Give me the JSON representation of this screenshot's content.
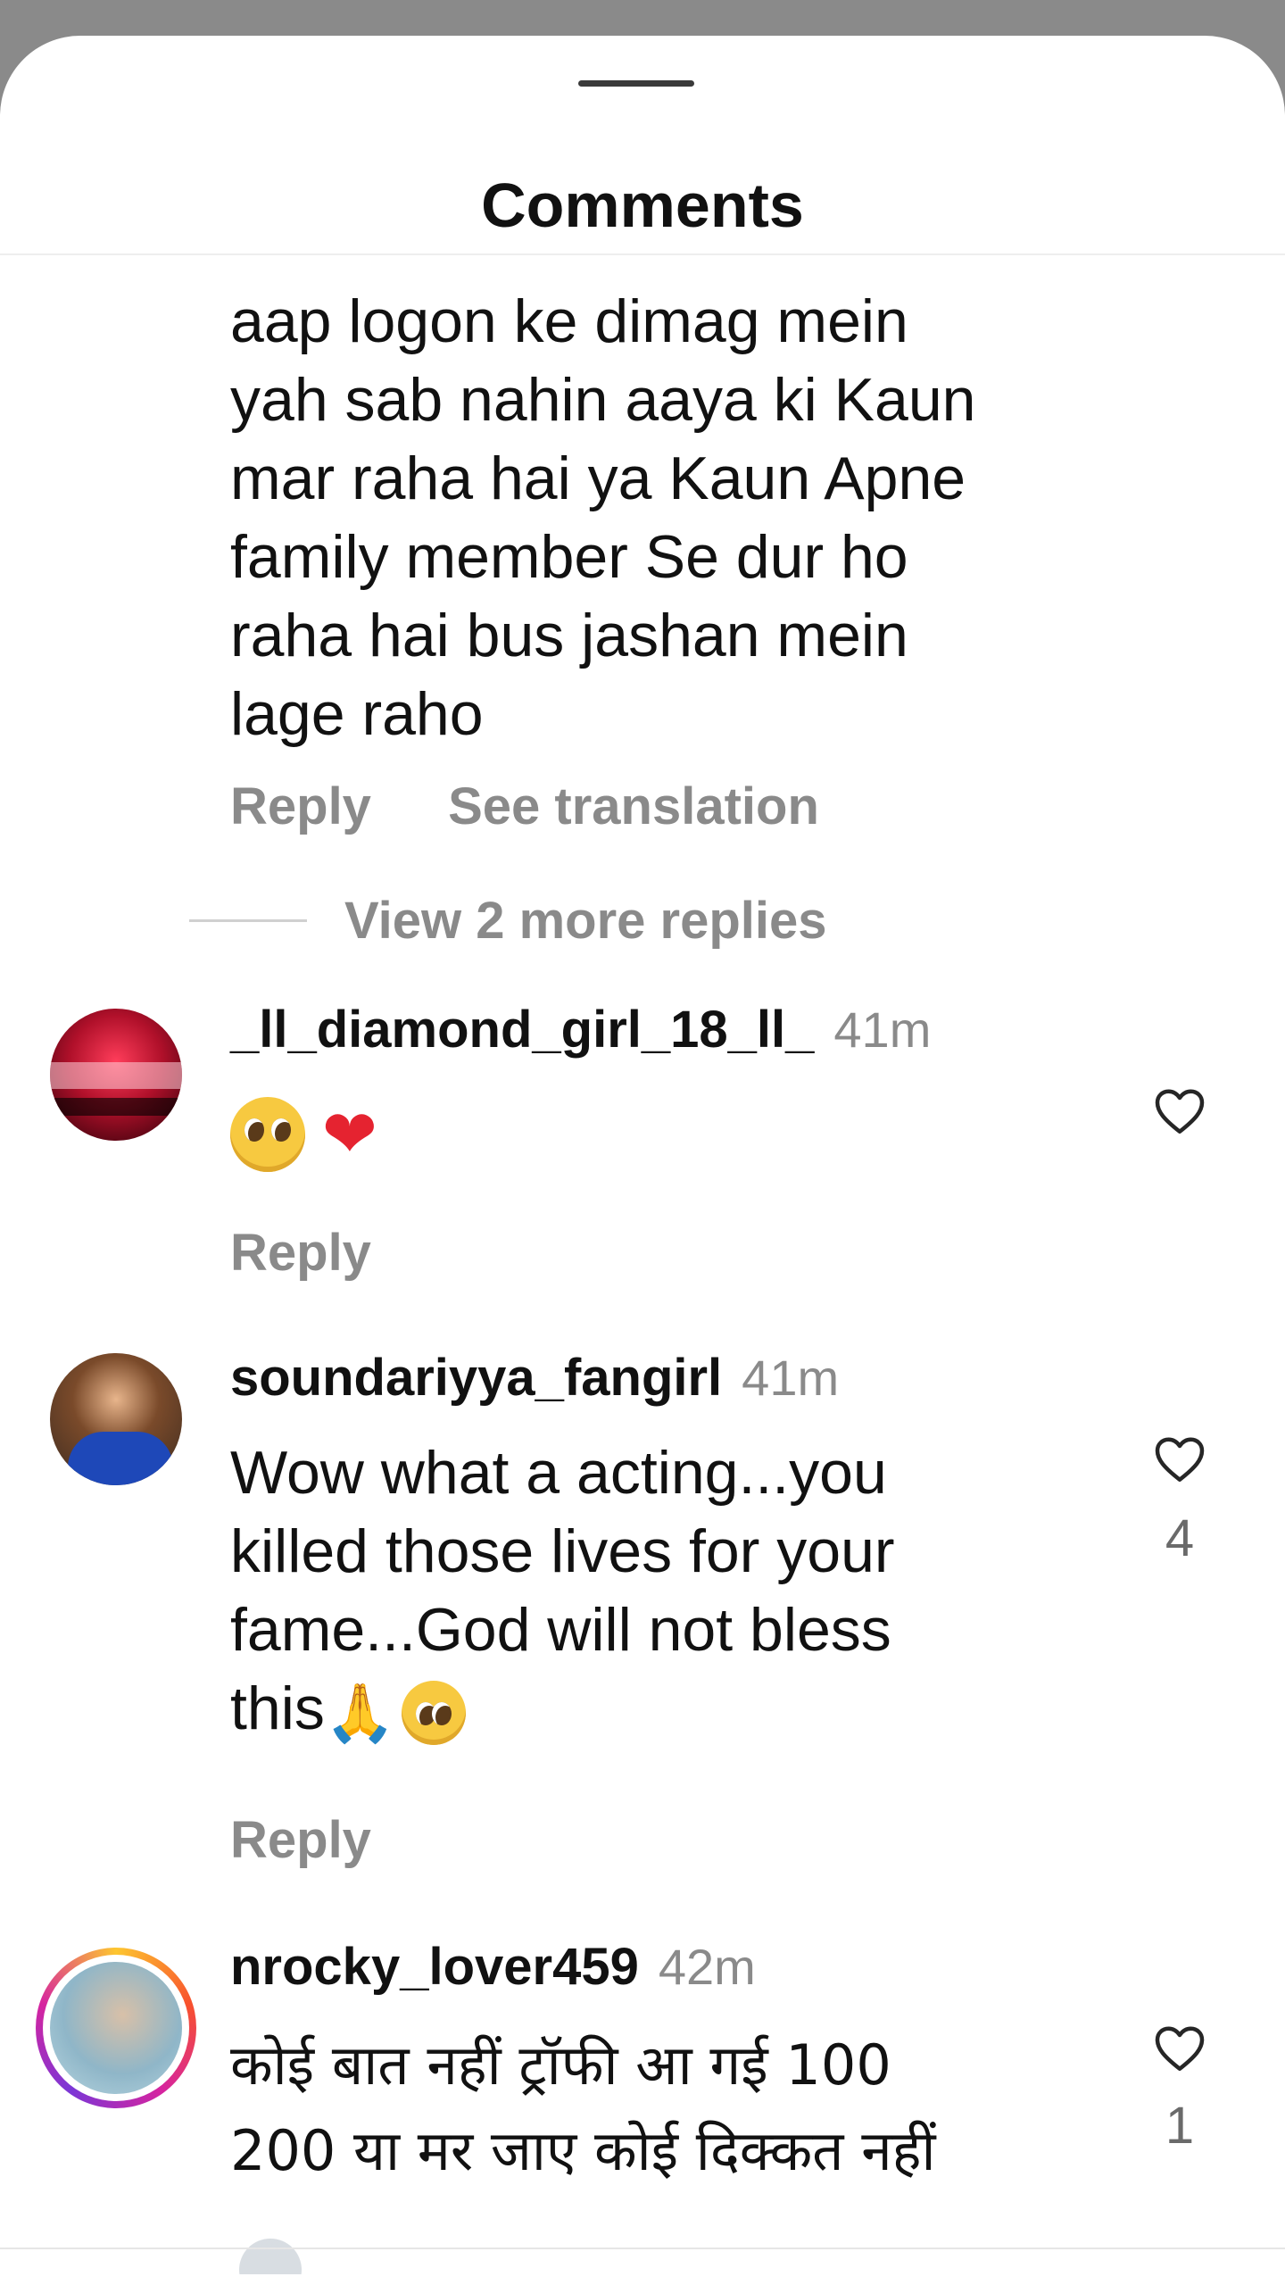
{
  "header": {
    "title": "Comments"
  },
  "comment0": {
    "lines": [
      "aap logon ke dimag mein",
      "yah sab nahin aaya ki Kaun",
      "mar raha hai ya Kaun Apne",
      "family member Se dur ho",
      "raha hai bus jashan mein",
      "lage raho"
    ],
    "reply": "Reply",
    "translation": "See translation",
    "view_replies": "View 2 more replies"
  },
  "comments": [
    {
      "username": "_ll_diamond_girl_18_ll_",
      "time": "41m",
      "emojis": [
        "pleading-face-emoji",
        "red-heart-emoji"
      ],
      "reply": "Reply",
      "likes": ""
    },
    {
      "username": "soundariyya_fangirl",
      "time": "41m",
      "lines": [
        "Wow what a acting...you",
        "killed those lives for your",
        "fame...God will not bless",
        "this"
      ],
      "reply": "Reply",
      "likes": "4"
    },
    {
      "username": "nrocky_lover459",
      "time": "42m",
      "lines": [
        "कोई बात नहीं ट्रॉफी आ गई 100",
        "200 या मर जाए कोई दिक्कत नहीं"
      ],
      "likes": "1"
    }
  ],
  "icons": [
    "heart-outline-icon"
  ]
}
